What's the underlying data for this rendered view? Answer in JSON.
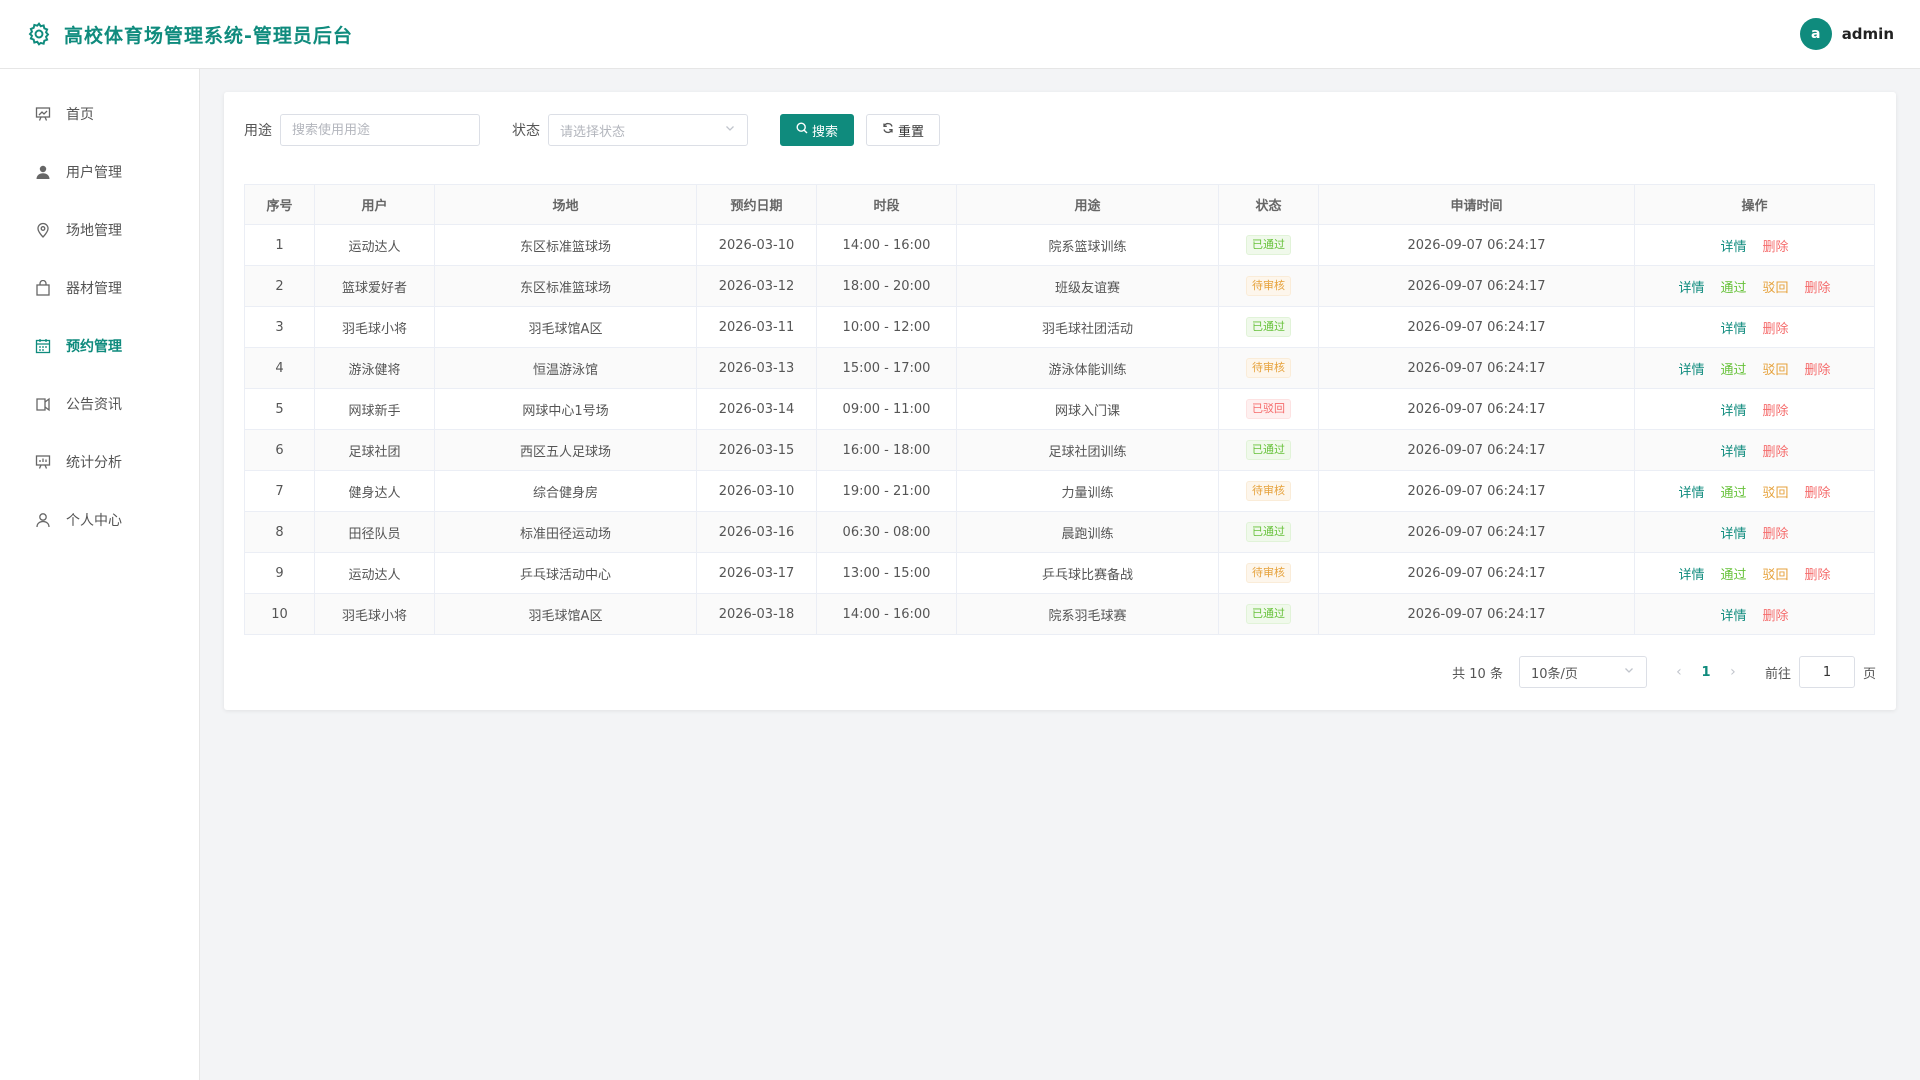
{
  "header": {
    "title": "高校体育场管理系统-管理员后台",
    "avatar_letter": "a",
    "username": "admin"
  },
  "colors": {
    "accent": "#0f8b7d",
    "success": "#67c23a",
    "warning": "#e6a23c",
    "danger": "#f56c6c"
  },
  "sidebar": {
    "items": [
      {
        "label": "首页",
        "icon": "chart-board-icon"
      },
      {
        "label": "用户管理",
        "icon": "user-solid-icon"
      },
      {
        "label": "场地管理",
        "icon": "location-icon"
      },
      {
        "label": "器材管理",
        "icon": "bag-icon"
      },
      {
        "label": "预约管理",
        "icon": "calendar-icon",
        "active": true
      },
      {
        "label": "公告资讯",
        "icon": "notice-icon"
      },
      {
        "label": "统计分析",
        "icon": "statistics-icon"
      },
      {
        "label": "个人中心",
        "icon": "user-icon"
      }
    ]
  },
  "search": {
    "purpose_label": "用途",
    "purpose_placeholder": "搜索使用用途",
    "status_label": "状态",
    "status_placeholder": "请选择状态",
    "search_button": "搜索",
    "reset_button": "重置"
  },
  "table": {
    "columns": [
      "序号",
      "用户",
      "场地",
      "预约日期",
      "时段",
      "用途",
      "状态",
      "申请时间",
      "操作"
    ],
    "rows": [
      {
        "no": "1",
        "user": "运动达人",
        "venue": "东区标准篮球场",
        "date": "2026-03-10",
        "slot": "14:00 - 16:00",
        "purpose": "院系篮球训练",
        "status": "已通过",
        "status_type": "approved",
        "applied": "2026-09-07 06:24:17"
      },
      {
        "no": "2",
        "user": "篮球爱好者",
        "venue": "东区标准篮球场",
        "date": "2026-03-12",
        "slot": "18:00 - 20:00",
        "purpose": "班级友谊赛",
        "status": "待审核",
        "status_type": "pending",
        "applied": "2026-09-07 06:24:17"
      },
      {
        "no": "3",
        "user": "羽毛球小将",
        "venue": "羽毛球馆A区",
        "date": "2026-03-11",
        "slot": "10:00 - 12:00",
        "purpose": "羽毛球社团活动",
        "status": "已通过",
        "status_type": "approved",
        "applied": "2026-09-07 06:24:17"
      },
      {
        "no": "4",
        "user": "游泳健将",
        "venue": "恒温游泳馆",
        "date": "2026-03-13",
        "slot": "15:00 - 17:00",
        "purpose": "游泳体能训练",
        "status": "待审核",
        "status_type": "pending",
        "applied": "2026-09-07 06:24:17"
      },
      {
        "no": "5",
        "user": "网球新手",
        "venue": "网球中心1号场",
        "date": "2026-03-14",
        "slot": "09:00 - 11:00",
        "purpose": "网球入门课",
        "status": "已驳回",
        "status_type": "rejected",
        "applied": "2026-09-07 06:24:17"
      },
      {
        "no": "6",
        "user": "足球社团",
        "venue": "西区五人足球场",
        "date": "2026-03-15",
        "slot": "16:00 - 18:00",
        "purpose": "足球社团训练",
        "status": "已通过",
        "status_type": "approved",
        "applied": "2026-09-07 06:24:17"
      },
      {
        "no": "7",
        "user": "健身达人",
        "venue": "综合健身房",
        "date": "2026-03-10",
        "slot": "19:00 - 21:00",
        "purpose": "力量训练",
        "status": "待审核",
        "status_type": "pending",
        "applied": "2026-09-07 06:24:17"
      },
      {
        "no": "8",
        "user": "田径队员",
        "venue": "标准田径运动场",
        "date": "2026-03-16",
        "slot": "06:30 - 08:00",
        "purpose": "晨跑训练",
        "status": "已通过",
        "status_type": "approved",
        "applied": "2026-09-07 06:24:17"
      },
      {
        "no": "9",
        "user": "运动达人",
        "venue": "乒乓球活动中心",
        "date": "2026-03-17",
        "slot": "13:00 - 15:00",
        "purpose": "乒乓球比赛备战",
        "status": "待审核",
        "status_type": "pending",
        "applied": "2026-09-07 06:24:17"
      },
      {
        "no": "10",
        "user": "羽毛球小将",
        "venue": "羽毛球馆A区",
        "date": "2026-03-18",
        "slot": "14:00 - 16:00",
        "purpose": "院系羽毛球赛",
        "status": "已通过",
        "status_type": "approved",
        "applied": "2026-09-07 06:24:17"
      }
    ],
    "actions": {
      "detail": "详情",
      "pass": "通过",
      "reject": "驳回",
      "delete": "删除"
    }
  },
  "pagination": {
    "total": "共 10 条",
    "page_size": "10条/页",
    "current_page": "1",
    "goto_label": "前往",
    "goto_value": "1",
    "page_unit": "页"
  }
}
